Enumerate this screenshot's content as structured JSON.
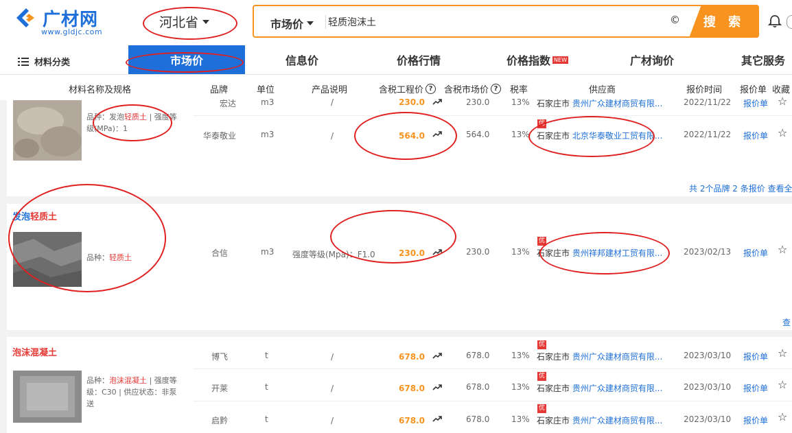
{
  "logo": {
    "text": "广材网",
    "url": "www.gldjc.com"
  },
  "province": "河北省",
  "search": {
    "type": "市场价",
    "query": "轻质泡沫土",
    "clear_glyph": "©",
    "button": "搜 索"
  },
  "nav": {
    "category": "材料分类",
    "items": [
      "市场价",
      "信息价",
      "价格行情",
      "价格指数",
      "广材询价",
      "其它服务"
    ],
    "new_badge": "NEW"
  },
  "table": {
    "headers": {
      "name": "材料名称及规格",
      "brand": "品牌",
      "unit": "单位",
      "desc": "产品说明",
      "eng_price": "含税工程价",
      "market_price": "含税市场价",
      "tax": "税率",
      "supplier": "供应商",
      "time": "报价时间",
      "quote": "报价单",
      "fav": "收藏"
    }
  },
  "groups": [
    {
      "desc_prefix": "品种：发泡",
      "desc_red": "轻质土",
      "desc_suffix": " | 强度等级(MPa)：1",
      "rows": [
        {
          "brand": "宏达",
          "unit": "m3",
          "desc": "/",
          "eng_price": "230.0",
          "market_price": "230.0",
          "tax": "13%",
          "city": "石家庄市",
          "supplier": "贵州广众建材商贸有限...",
          "time": "2022/11/22",
          "quote": "报价单"
        },
        {
          "brand": "华泰敬业",
          "unit": "m3",
          "desc": "/",
          "eng_price": "564.0",
          "market_price": "564.0",
          "tax": "13%",
          "city": "石家庄市",
          "supplier": "北京华泰敬业工贸有限...",
          "time": "2022/11/22",
          "quote": "报价单",
          "badge": "优"
        }
      ],
      "summary": "共 2个品牌 2 条报价  查看全"
    },
    {
      "title_blue": "发泡",
      "title_red": "轻质土",
      "desc_prefix": "品种：",
      "desc_red": "轻质土",
      "rows": [
        {
          "brand": "合信",
          "unit": "m3",
          "desc": "强度等级(Mpa)：F1.0",
          "eng_price": "230.0",
          "market_price": "230.0",
          "tax": "13%",
          "city": "石家庄市",
          "supplier": "贵州祥邦建材工贸有限...",
          "time": "2023/02/13",
          "quote": "报价单",
          "badge": "优"
        }
      ],
      "summary": "查"
    },
    {
      "title_red1": "泡沫",
      "title_red2": "混凝土",
      "desc_prefix": "品种：",
      "desc_red": "泡沫混凝土",
      "desc_suffix": " | 强度等级：C30 | 供应状态：非泵送",
      "rows": [
        {
          "brand": "博飞",
          "unit": "t",
          "desc": "/",
          "eng_price": "678.0",
          "market_price": "678.0",
          "tax": "13%",
          "city": "石家庄市",
          "supplier": "贵州广众建材商贸有限...",
          "time": "2023/03/10",
          "quote": "报价单",
          "badge": "优"
        },
        {
          "brand": "开莱",
          "unit": "t",
          "desc": "/",
          "eng_price": "678.0",
          "market_price": "678.0",
          "tax": "13%",
          "city": "石家庄市",
          "supplier": "贵州广众建材商贸有限...",
          "time": "2023/03/10",
          "quote": "报价单",
          "badge": "优"
        },
        {
          "brand": "启黔",
          "unit": "t",
          "desc": "/",
          "eng_price": "678.0",
          "market_price": "678.0",
          "tax": "13%",
          "city": "石家庄市",
          "supplier": "贵州广众建材商贸有限...",
          "time": "2023/03/10",
          "quote": "报价单",
          "badge": "优"
        }
      ]
    }
  ],
  "colors": {
    "accent": "#1e6fd9",
    "orange": "#f7931e",
    "red": "#e53935",
    "annotation": "#e02020"
  }
}
